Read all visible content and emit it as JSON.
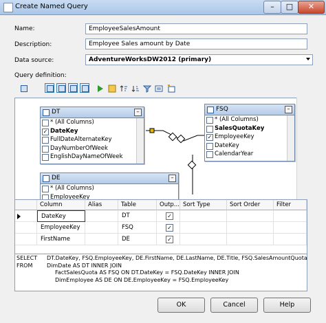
{
  "window": {
    "title": "Create Named Query"
  },
  "form": {
    "name_label": "Name:",
    "name_value": "EmployeeSalesAmount",
    "description_label": "Description:",
    "description_value": "Employee Sales amount by Date",
    "datasource_label": "Data source:",
    "datasource_value": "AdventureWorksDW2012 (primary)",
    "query_label": "Query definition:"
  },
  "tables": {
    "dt": {
      "name": "DT",
      "columns": [
        "* (All Columns)",
        "DateKey",
        "FullDateAlternateKey",
        "DayNumberOfWeek",
        "EnglishDayNameOfWeek"
      ],
      "checked": [
        false,
        true,
        false,
        false,
        false
      ]
    },
    "fsq": {
      "name": "FSQ",
      "columns": [
        "* (All Columns)",
        "SalesQuotaKey",
        "EmployeeKey",
        "DateKey",
        "CalendarYear"
      ],
      "checked": [
        false,
        false,
        true,
        false,
        false
      ]
    },
    "de": {
      "name": "DE",
      "columns": [
        "* (All Columns)",
        "EmployeeKey"
      ],
      "checked": [
        false,
        false
      ]
    }
  },
  "grid": {
    "headers": [
      "Column",
      "Alias",
      "Table",
      "Outp...",
      "Sort Type",
      "Sort Order",
      "Filter"
    ],
    "rows": [
      {
        "column": "DateKey",
        "alias": "",
        "table": "DT",
        "output": true
      },
      {
        "column": "EmployeeKey",
        "alias": "",
        "table": "FSQ",
        "output": true
      },
      {
        "column": "FirstName",
        "alias": "",
        "table": "DE",
        "output": true
      }
    ]
  },
  "sql": {
    "lines": [
      [
        "SELECT",
        "DT.DateKey, FSQ.EmployeeKey, DE.FirstName, DE.LastName, DE.Title, FSQ.SalesAmountQuota"
      ],
      [
        "FROM",
        "DimDate AS DT INNER JOIN"
      ],
      [
        "",
        "FactSalesQuota AS FSQ ON DT.DateKey = FSQ.DateKey INNER JOIN"
      ],
      [
        "",
        "DimEmployee AS DE ON DE.EmployeeKey = FSQ.EmployeeKey"
      ]
    ]
  },
  "buttons": {
    "ok": "OK",
    "cancel": "Cancel",
    "help": "Help"
  },
  "titlebar_buttons": {
    "minimize": "–",
    "maximize": "□",
    "close": "✕"
  }
}
